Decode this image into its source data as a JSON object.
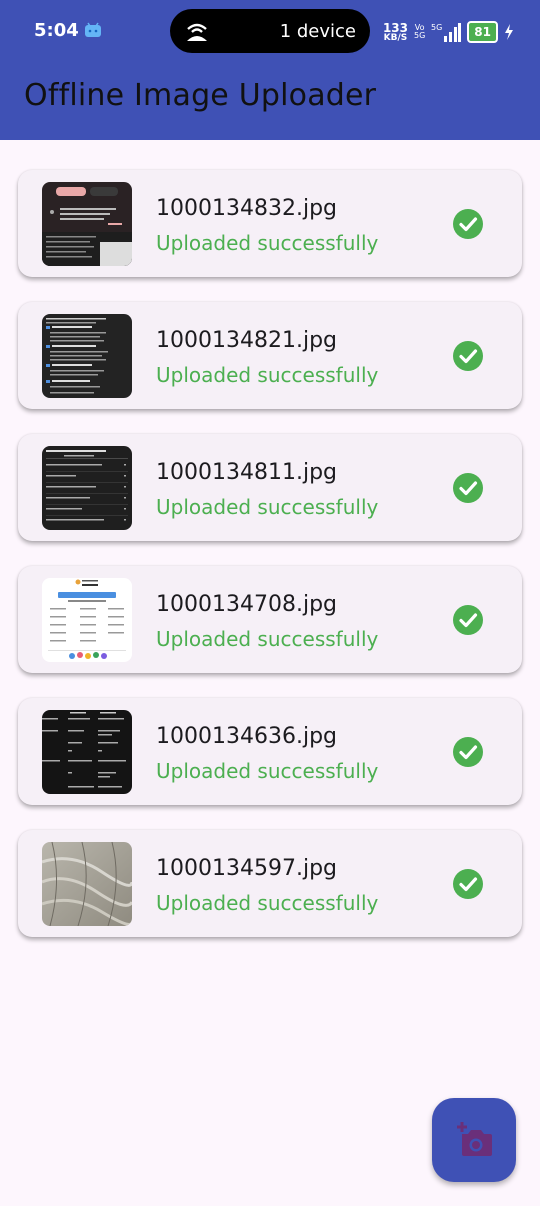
{
  "status_bar": {
    "time": "5:04",
    "devices": "1 device",
    "net_speed_value": "133",
    "net_speed_unit": "KB/S",
    "volte_top": "Vo",
    "volte_bottom": "5G",
    "network": "5G",
    "battery": "81"
  },
  "app_bar": {
    "title": "Offline Image Uploader"
  },
  "uploads": [
    {
      "file_name": "1000134832.jpg",
      "status": "Uploaded successfully"
    },
    {
      "file_name": "1000134821.jpg",
      "status": "Uploaded successfully"
    },
    {
      "file_name": "1000134811.jpg",
      "status": "Uploaded successfully"
    },
    {
      "file_name": "1000134708.jpg",
      "status": "Uploaded successfully"
    },
    {
      "file_name": "1000134636.jpg",
      "status": "Uploaded successfully"
    },
    {
      "file_name": "1000134597.jpg",
      "status": "Uploaded successfully"
    }
  ],
  "colors": {
    "primary": "#3f51b5",
    "success": "#4caf50",
    "background": "#fdf6fd",
    "card": "#f6f0f7"
  },
  "fab": {
    "icon": "add-a-photo-icon"
  }
}
